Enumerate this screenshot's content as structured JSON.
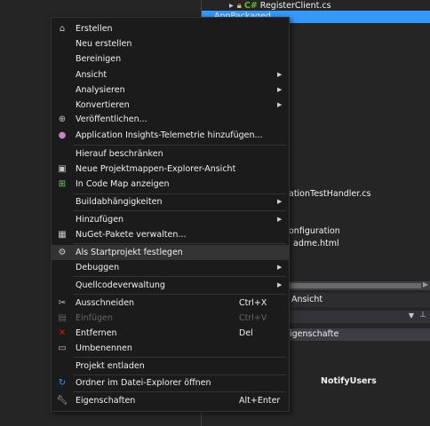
{
  "solution_explorer": {
    "register_client": "RegisterClient.cs",
    "app_packaged": "AppPackaged",
    "handler_file": "ationTestHandler.cs",
    "configuration": "onfiguration",
    "readme": "adme.html",
    "cs_badge": "C#"
  },
  "properties": {
    "header": "Ansicht",
    "row_label": "igenschafte",
    "value": "NotifyUsers"
  },
  "menu": {
    "items": [
      {
        "label": "Erstellen",
        "icon": "build-icon"
      },
      {
        "label": "Neu erstellen"
      },
      {
        "label": "Bereinigen"
      },
      {
        "label": "Ansicht",
        "submenu": true
      },
      {
        "label": "Analysieren",
        "submenu": true
      },
      {
        "label": "Konvertieren",
        "submenu": true
      },
      {
        "label": "Veröffentlichen...",
        "icon": "globe-icon"
      },
      {
        "label": "Application Insights-Telemetrie hinzufügen...",
        "icon": "lightbulb-icon"
      },
      {
        "label": "Hierauf beschränken"
      },
      {
        "label": "Neue Projektmappen-Explorer-Ansicht",
        "icon": "new-view-icon"
      },
      {
        "label": "In Code Map anzeigen",
        "icon": "code-map-icon"
      },
      {
        "label": "Buildabhängigkeiten",
        "submenu": true
      },
      {
        "label": "Hinzufügen",
        "submenu": true
      },
      {
        "label": "NuGet-Pakete verwalten...",
        "icon": "package-icon"
      },
      {
        "label": "Als Startprojekt festlegen",
        "icon": "gear-icon"
      },
      {
        "label": "Debuggen",
        "submenu": true
      },
      {
        "label": "Quellcodeverwaltung",
        "submenu": true
      },
      {
        "label": "Ausschneiden",
        "icon": "scissors-icon",
        "shortcut": "Ctrl+X"
      },
      {
        "label": "Einfügen",
        "icon": "paste-icon",
        "shortcut": "Ctrl+V",
        "disabled": true
      },
      {
        "label": "Entfernen",
        "icon": "delete-icon",
        "shortcut": "Del"
      },
      {
        "label": "Umbenennen",
        "icon": "rename-icon"
      },
      {
        "label": "Projekt entladen"
      },
      {
        "label": "Ordner im Datei-Explorer öffnen",
        "icon": "refresh-icon"
      },
      {
        "label": "Eigenschaften",
        "icon": "wrench-icon",
        "shortcut": "Alt+Enter"
      }
    ]
  },
  "colors": {
    "menu_bg": "#1b1b1c",
    "highlight": "#333334",
    "selection": "#3399ff",
    "delete": "#e51400"
  }
}
